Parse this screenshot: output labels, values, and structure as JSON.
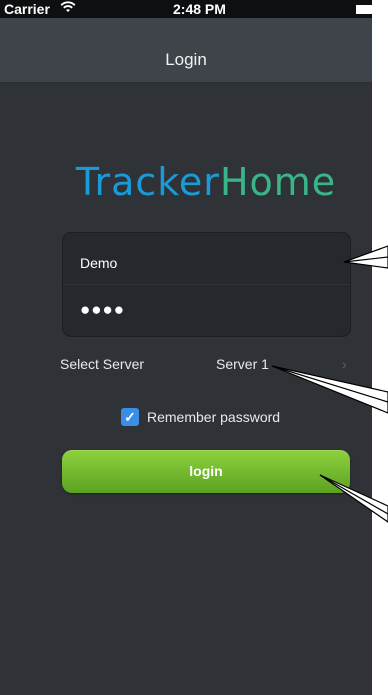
{
  "status_bar": {
    "carrier": "Carrier",
    "wifi_icon": "wifi-icon",
    "time": "2:48 PM",
    "battery_icon": "battery-icon"
  },
  "nav": {
    "title": "Login"
  },
  "logo": {
    "part1": "Tracker",
    "part2": "Home",
    "colors": {
      "part1": "#1a9bd8",
      "part2": "#38b68a"
    }
  },
  "form": {
    "username_value": "Demo",
    "password_mask": "●●●●",
    "server_label": "Select Server",
    "server_value": "Server 1",
    "chevron": "›",
    "remember_label": "Remember password",
    "remember_checked": true,
    "login_label": "login"
  },
  "colors": {
    "background": "#2f3338",
    "nav_bar": "#3f444a",
    "login_button": "#6fb82a",
    "checkbox": "#3a8ee6"
  }
}
